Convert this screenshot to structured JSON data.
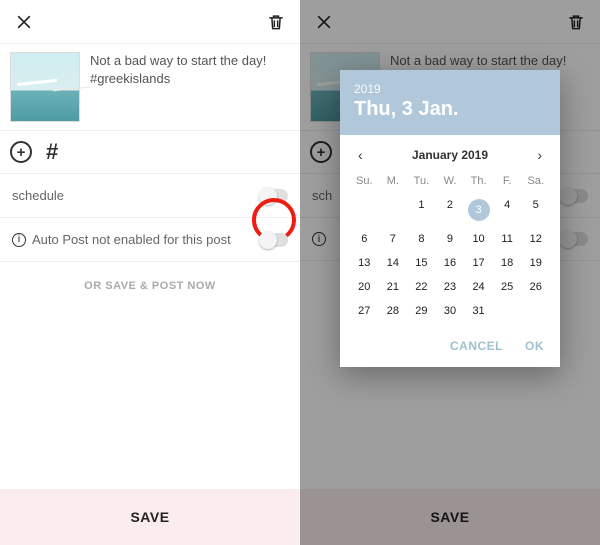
{
  "left": {
    "caption": "Not a bad way to start the day! #greekislands",
    "schedule_label": "schedule",
    "autopost_label": "Auto Post not enabled for this post",
    "or_label": "OR SAVE & POST NOW",
    "save_label": "SAVE"
  },
  "right": {
    "save_label": "SAVE",
    "sch_label": "sch"
  },
  "picker": {
    "year": "2019",
    "date_long": "Thu, 3 Jan.",
    "month_title": "January 2019",
    "dow": [
      "Su.",
      "M.",
      "Tu.",
      "W.",
      "Th.",
      "F.",
      "Sa."
    ],
    "pre_blanks": 2,
    "days": 31,
    "selected": 3,
    "cancel": "CANCEL",
    "ok": "OK"
  }
}
